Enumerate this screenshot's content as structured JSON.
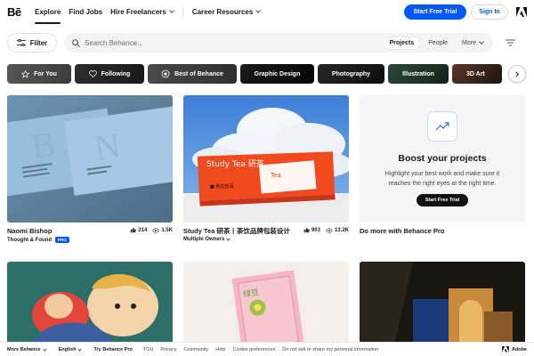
{
  "header": {
    "logo": "Bē",
    "nav": [
      "Explore",
      "Find Jobs",
      "Hire Freelancers",
      "Career Resources"
    ],
    "start_trial": "Start Free Trial",
    "sign_in": "Sign In"
  },
  "search": {
    "filter_label": "Filter",
    "placeholder": "Search Behance...",
    "tabs": [
      "Projects",
      "People",
      "More"
    ],
    "active_tab": "Projects"
  },
  "categories": [
    {
      "label": "For You",
      "icon": "star-icon"
    },
    {
      "label": "Following",
      "icon": "heart-icon"
    },
    {
      "label": "Best of Behance",
      "icon": "behance-badge-icon"
    },
    {
      "label": "Graphic Design",
      "icon": ""
    },
    {
      "label": "Photography",
      "icon": ""
    },
    {
      "label": "Illustration",
      "icon": ""
    },
    {
      "label": "3D Art",
      "icon": ""
    }
  ],
  "projects": [
    {
      "owner": "Naomi Bishop",
      "subtitle": "Thought & Found",
      "badge": "PRO",
      "likes": "214",
      "views": "1.5K"
    },
    {
      "owner": "Study Tea 研茶丨茶饮品牌包装设计",
      "subtitle": "Multiple Owners",
      "likes": "903",
      "views": "13.2K"
    },
    {
      "owner": "Do more with Behance Pro"
    }
  ],
  "promo": {
    "title": "Boost your projects",
    "text": "Highlight your best work and make sure it reaches the right eyes at the right time.",
    "button": "Start Free Trial"
  },
  "thumb_text": {
    "tea_title": "Study Tea 研茶",
    "tea_sub": "Tea",
    "tea_box": "■ 熟庄普洱"
  },
  "footer": {
    "items": [
      "More Behance",
      "English",
      "Try Behance Pro",
      "TOU",
      "Privacy",
      "Community",
      "Help",
      "Cookie preferences",
      "Do not sell or share my personal information"
    ],
    "brand": "Adobe"
  },
  "colors": {
    "accent": "#0057ff",
    "chip_for_you": "#4a4a4a",
    "chip_following": "#242424",
    "chip_best": "#3a3a3a",
    "chip_graphic": "#111111",
    "chip_photo": "#1c1c1c",
    "chip_illustration": "#1e3a30",
    "chip_3d": "#3a2a22"
  }
}
